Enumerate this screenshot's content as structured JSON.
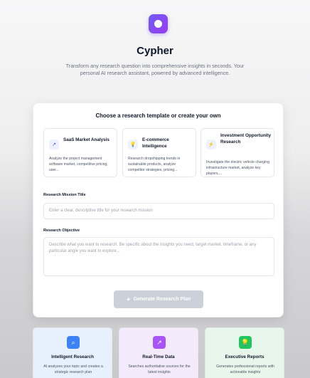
{
  "app": {
    "name": "Cypher",
    "tagline": "Transform any research question into comprehensive insights in seconds. Your personal AI research assistant, powered by advanced intelligence.",
    "logo_icon": "circle-logo-icon",
    "accent": "#7c4df2"
  },
  "form": {
    "heading": "Choose a research template or create your own",
    "templates": [
      {
        "icon": "trending-up-icon",
        "glyph": "↗",
        "name": "SaaS Market Analysis",
        "desc": "Analyze the project management software market, competitive pricing, user..."
      },
      {
        "icon": "lightbulb-icon",
        "glyph": "💡",
        "name": "E-commerce Intelligence",
        "desc": "Research dropshipping trends in sustainable products, analyze competitor strategies, pricing..."
      },
      {
        "icon": "lightning-icon",
        "glyph": "⚡",
        "name": "Investment Opportunity Research",
        "desc": "Investigate the electric vehicle charging infrastructure market, analyze key players,..."
      }
    ],
    "title_label": "Research Mission Title",
    "title_placeholder": "Enter a clear, descriptive title for your research mission",
    "objective_label": "Research Objective",
    "objective_placeholder": "Describe what you want to research. Be specific about the insights you need, target market, timeframe, or any particular angle you want to explore...",
    "submit_label": "Generate Research Plan",
    "submit_icon": "sparkle-icon"
  },
  "features": [
    {
      "icon": "search-icon",
      "glyph": "⌕",
      "color": "#3b82f6",
      "bg": "#e7f0fd",
      "title": "Intelligent Research",
      "desc": "AI analyzes your topic and creates a strategic research plan"
    },
    {
      "icon": "trending-up-icon",
      "glyph": "↗",
      "color": "#a855f7",
      "bg": "#f3ebfb",
      "title": "Real-Time Data",
      "desc": "Searches authoritative sources for the latest insights"
    },
    {
      "icon": "lightbulb-icon",
      "glyph": "💡",
      "color": "#22c55e",
      "bg": "#e8f7ec",
      "title": "Executive Reports",
      "desc": "Generates professional reports with actionable insights"
    }
  ]
}
